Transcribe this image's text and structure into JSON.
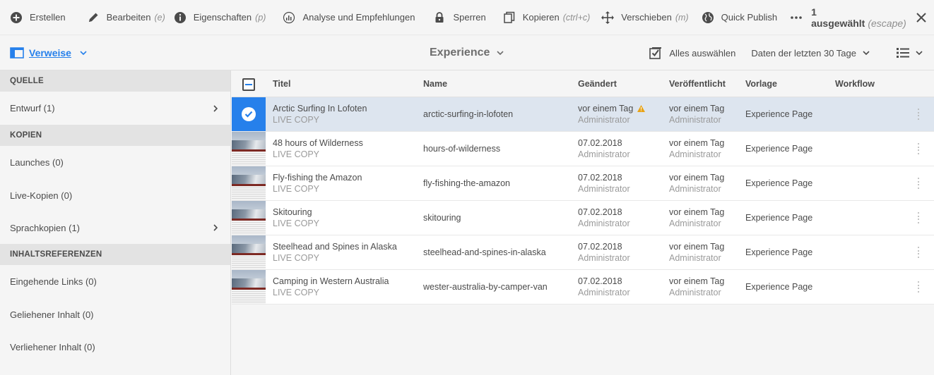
{
  "toolbar": {
    "create": "Erstellen",
    "edit": "Bearbeiten",
    "edit_hint": "(e)",
    "properties": "Eigenschaften",
    "properties_hint": "(p)",
    "analysis": "Analyse und Empfehlungen",
    "lock": "Sperren",
    "copy": "Kopieren",
    "copy_hint": "(ctrl+c)",
    "move": "Verschieben",
    "move_hint": "(m)",
    "quick_publish": "Quick Publish",
    "selection_count": "1 ausgewählt",
    "selection_hint": "(escape)"
  },
  "subbar": {
    "references": "Verweise",
    "title": "Experience",
    "select_all": "Alles auswählen",
    "date_filter": "Daten der letzten 30 Tage"
  },
  "rail": {
    "sections": [
      {
        "heading": "QUELLE",
        "items": [
          {
            "label": "Entwurf (1)",
            "has_arrow": true
          }
        ]
      },
      {
        "heading": "KOPIEN",
        "items": [
          {
            "label": "Launches (0)"
          },
          {
            "label": "Live-Kopien (0)"
          },
          {
            "label": "Sprachkopien (1)",
            "has_arrow": true
          }
        ]
      },
      {
        "heading": "INHALTSREFERENZEN",
        "items": [
          {
            "label": "Eingehende Links (0)"
          },
          {
            "label": "Geliehener Inhalt (0)"
          },
          {
            "label": "Verliehener Inhalt (0)"
          }
        ]
      }
    ]
  },
  "table": {
    "headers": {
      "title": "Titel",
      "name": "Name",
      "modified": "Geändert",
      "published": "Veröffentlicht",
      "template": "Vorlage",
      "workflow": "Workflow"
    },
    "rows": [
      {
        "title": "Arctic Surfing In Lofoten",
        "subtitle": "LIVE COPY",
        "name": "arctic-surfing-in-lofoten",
        "modified": "vor einem Tag",
        "modified_by": "Administrator",
        "published": "vor einem Tag",
        "published_by": "Administrator",
        "template": "Experience Page",
        "selected": true,
        "warning": true
      },
      {
        "title": "48 hours of Wilderness",
        "subtitle": "LIVE COPY",
        "name": "hours-of-wilderness",
        "modified": "07.02.2018",
        "modified_by": "Administrator",
        "published": "vor einem Tag",
        "published_by": "Administrator",
        "template": "Experience Page"
      },
      {
        "title": "Fly-fishing the Amazon",
        "subtitle": "LIVE COPY",
        "name": "fly-fishing-the-amazon",
        "modified": "07.02.2018",
        "modified_by": "Administrator",
        "published": "vor einem Tag",
        "published_by": "Administrator",
        "template": "Experience Page"
      },
      {
        "title": "Skitouring",
        "subtitle": "LIVE COPY",
        "name": "skitouring",
        "modified": "07.02.2018",
        "modified_by": "Administrator",
        "published": "vor einem Tag",
        "published_by": "Administrator",
        "template": "Experience Page"
      },
      {
        "title": "Steelhead and Spines in Alaska",
        "subtitle": "LIVE COPY",
        "name": "steelhead-and-spines-in-alaska",
        "modified": "07.02.2018",
        "modified_by": "Administrator",
        "published": "vor einem Tag",
        "published_by": "Administrator",
        "template": "Experience Page"
      },
      {
        "title": "Camping in Western Australia",
        "subtitle": "LIVE COPY",
        "name": "wester-australia-by-camper-van",
        "modified": "07.02.2018",
        "modified_by": "Administrator",
        "published": "vor einem Tag",
        "published_by": "Administrator",
        "template": "Experience Page"
      }
    ]
  },
  "colors": {
    "accent": "#2680eb",
    "selected_row": "#dde5ef",
    "warning": "#e8a317"
  }
}
